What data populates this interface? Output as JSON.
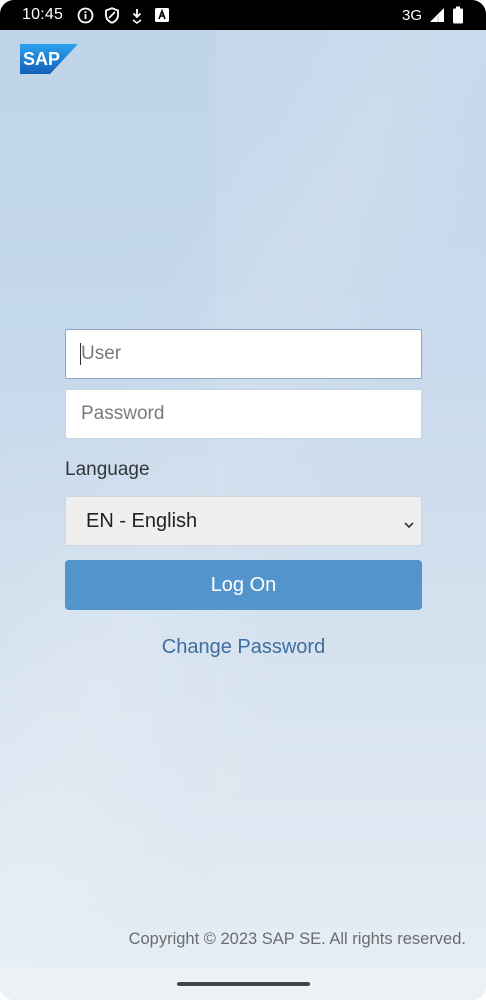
{
  "status_bar": {
    "time": "10:45",
    "network": "3G",
    "icons_left": [
      "info-icon",
      "shield-icon",
      "download-icon",
      "a-box-icon"
    ],
    "icons_right": [
      "signal-icon",
      "battery-icon"
    ]
  },
  "logo": {
    "text": "SAP",
    "icon": "sap-logo-icon",
    "color": "#1a73c8"
  },
  "login": {
    "user_placeholder": "User",
    "user_value": "",
    "password_placeholder": "Password",
    "password_value": "",
    "language_label": "Language",
    "language_selected": "EN - English",
    "logon_label": "Log On",
    "change_password_label": "Change Password"
  },
  "footer": {
    "copyright": "Copyright © 2023 SAP SE. All rights reserved."
  },
  "colors": {
    "accent": "#5494cd",
    "link": "#3f6fa0",
    "background_top": "#bfd4e9",
    "background_bottom": "#e7eef5"
  }
}
